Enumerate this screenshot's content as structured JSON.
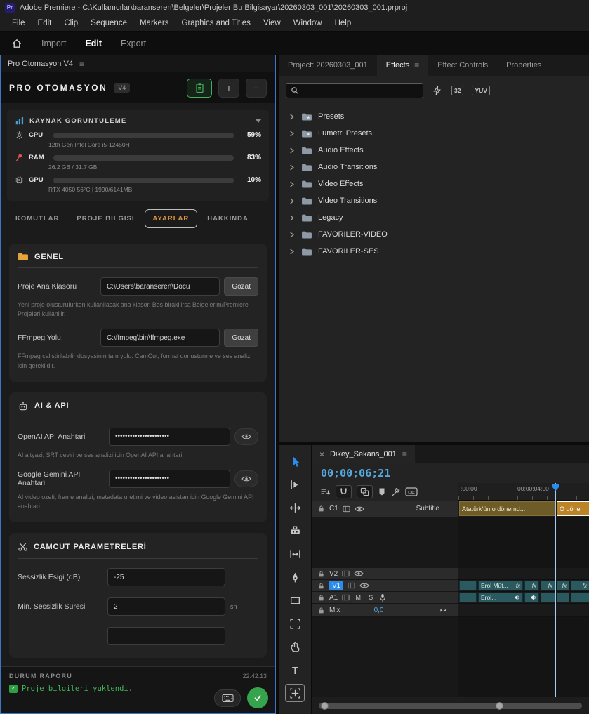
{
  "titlebar": {
    "app_icon": "Pr",
    "title": "Adobe Premiere - C:\\Kullanıcılar\\baranseren\\Belgeler\\Projeler Bu Bilgisayar\\20260303_001\\20260303_001.prproj"
  },
  "menubar": {
    "items": [
      "File",
      "Edit",
      "Clip",
      "Sequence",
      "Markers",
      "Graphics and Titles",
      "View",
      "Window",
      "Help"
    ]
  },
  "workspace": {
    "tabs": [
      "Import",
      "Edit",
      "Export"
    ],
    "active": "Edit"
  },
  "automation_panel": {
    "tab_title": "Pro Otomasyon V4",
    "title": "PRO OTOMASYON",
    "version": "V4",
    "resources": {
      "title": "KAYNAK GORUNTULEME",
      "rows": [
        {
          "label": "CPU",
          "percent": "59%",
          "detail": "12th Gen Intel Core i5-12450H"
        },
        {
          "label": "RAM",
          "percent": "83%",
          "detail": "26.2 GB / 31.7 GB"
        },
        {
          "label": "GPU",
          "percent": "10%",
          "detail": "RTX 4050 56°C | 1990/6141MB"
        }
      ]
    },
    "tabs": [
      "KOMUTLAR",
      "PROJE BILGISI",
      "AYARLAR",
      "HAKKINDA"
    ],
    "active_tab": "AYARLAR",
    "genel": {
      "title": "GENEL",
      "fields": [
        {
          "label": "Proje Ana Klasoru",
          "value": "C:\\Users\\baranseren\\Docu",
          "button": "Gozat",
          "help": "Yeni proje olusturulurken kullanilacak ana klasor. Bos birakilirsa Belgelerim/Premiere Projeleri kullanilir."
        },
        {
          "label": "FFmpeg Yolu",
          "value": "C:\\ffmpeg\\bin\\ffmpeg.exe",
          "button": "Gozat",
          "help": "FFmpeg calistirilabilir dosyasinin tam yolu. CamCut, format donusturme ve ses analizi icin gereklidir."
        }
      ]
    },
    "ai_api": {
      "title": "AI & API",
      "fields": [
        {
          "label": "OpenAI API Anahtari",
          "value": "••••••••••••••••••••••",
          "help": "AI altyazi, SRT ceviri ve ses analizi icin OpenAI API anahtari."
        },
        {
          "label": "Google Gemini API Anahtari",
          "value": "••••••••••••••••••••••",
          "help": "AI video ozeti, frame analizi, metadata uretimi ve video asistan icin Google Gemini API anahtari."
        }
      ]
    },
    "camcut": {
      "title": "CAMCUT PARAMETRELERİ",
      "fields": [
        {
          "label": "Sessizlik Esigi (dB)",
          "value": "-25",
          "suffix": ""
        },
        {
          "label": "Min. Sessizlik Suresi",
          "value": "2",
          "suffix": "sn"
        }
      ]
    },
    "status": {
      "title": "DURUM RAPORU",
      "time": "22:42:13",
      "message": "Proje bilgileri yuklendi."
    }
  },
  "effects_panel": {
    "tabs": [
      "Project: 20260303_001",
      "Effects",
      "Effect Controls",
      "Properties"
    ],
    "active_tab": "Effects",
    "search_value": "",
    "filters": {
      "bit32": "32",
      "yuv": "YUV"
    },
    "tree": [
      "Presets",
      "Lumetri Presets",
      "Audio Effects",
      "Audio Transitions",
      "Video Effects",
      "Video Transitions",
      "Legacy",
      "FAVORILER-VIDEO",
      "FAVORILER-SES"
    ]
  },
  "timeline": {
    "tab": "Dikey_Sekans_001",
    "timecode": "00;00;06;21",
    "ruler_labels": [
      ";00;00",
      "00;00;04;00"
    ],
    "cc_badge": "CC",
    "fx_badge": "fx",
    "tracks": {
      "c1": {
        "name": "C1",
        "format": "Subtitle",
        "clips": [
          "Atatürk'ün o dönemd...",
          "O döne"
        ]
      },
      "v2": {
        "name": "V2"
      },
      "v1": {
        "name": "V1",
        "clip_label": "Erol Müt..."
      },
      "a1": {
        "name": "A1",
        "mute": "M",
        "solo": "S",
        "clip_label": "Erol..."
      },
      "mix": {
        "name": "Mix",
        "value": "0,0"
      }
    }
  }
}
